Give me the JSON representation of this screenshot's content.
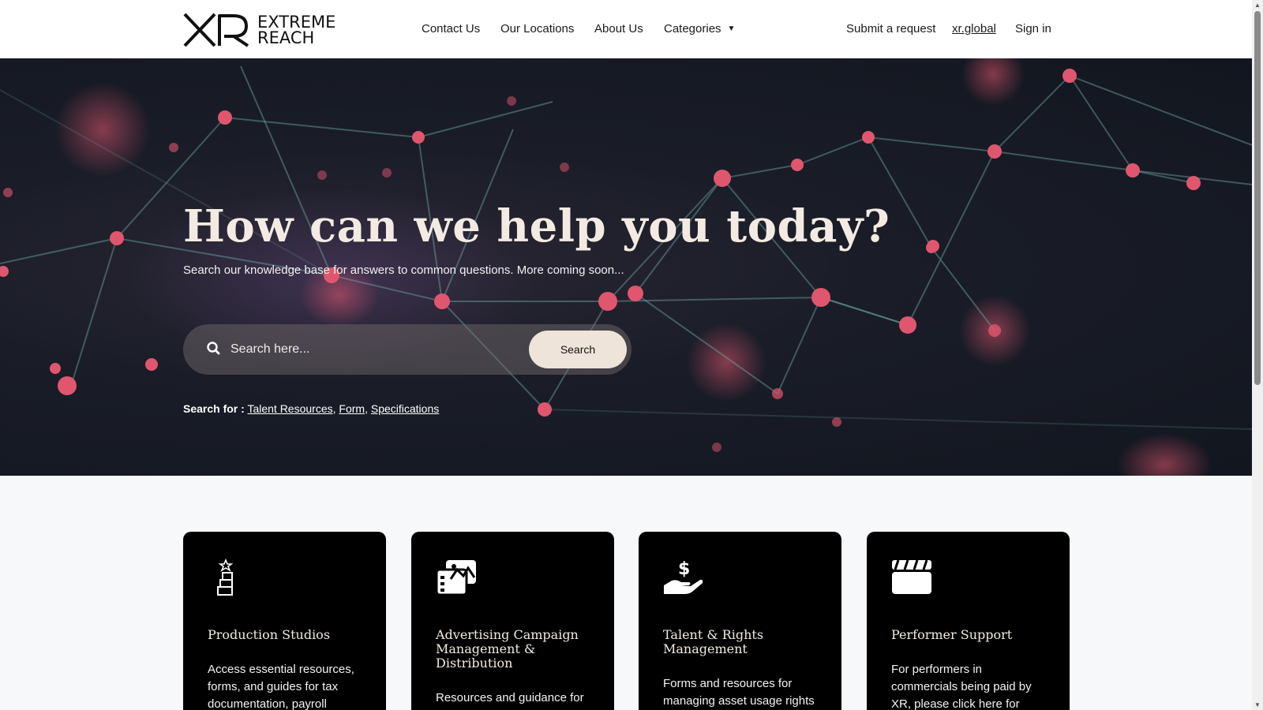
{
  "brand": {
    "logo_text_line1": "EXTREME",
    "logo_text_line2": "REACH"
  },
  "nav": {
    "contact": "Contact Us",
    "locations": "Our Locations",
    "about": "About Us",
    "categories": "Categories",
    "submit": "Submit a request",
    "xr_global": "xr.global",
    "sign_in": "Sign in"
  },
  "hero": {
    "title": "How can we help you today?",
    "subtitle": "Search our knowledge base for answers to common questions. More coming soon...",
    "search_placeholder": "Search here...",
    "search_button": "Search",
    "search_for_label": "Search for :",
    "suggestions": [
      "Talent Resources",
      "Form",
      "Specifications"
    ]
  },
  "cards": [
    {
      "icon": "stacked-box-star-icon",
      "title": "Production Studios",
      "description": "Access essential resources, forms, and guides for tax documentation, payroll"
    },
    {
      "icon": "photo-gallery-icon",
      "title": "Advertising Campaign Management & Distribution",
      "description": "Resources and guidance for"
    },
    {
      "icon": "hand-dollar-icon",
      "title": "Talent & Rights Management",
      "description": "Forms and resources for managing asset usage rights"
    },
    {
      "icon": "clapperboard-icon",
      "title": "Performer Support",
      "description": "For performers in commercials being paid by XR, please click here for"
    }
  ],
  "colors": {
    "hero_bg": "#1a1d28",
    "title_cream": "#f3ebe3",
    "button_bg": "#efe4da",
    "card_bg": "#000000",
    "node_pink": "#e0566e"
  }
}
